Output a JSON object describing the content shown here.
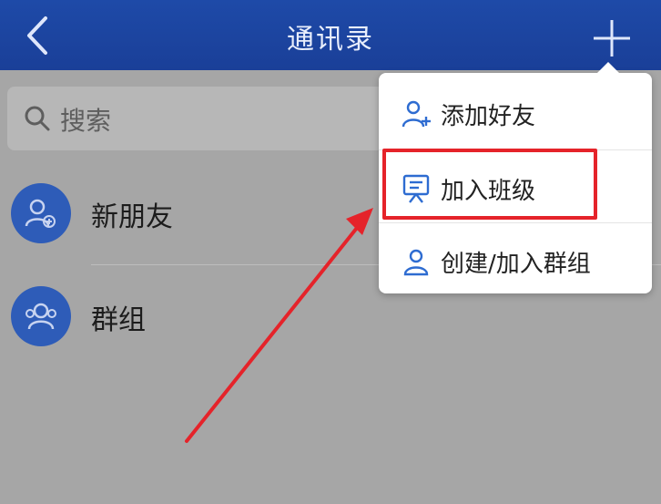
{
  "header": {
    "title": "通讯录",
    "back_icon": "chevron-left-icon",
    "add_icon": "plus-icon"
  },
  "search": {
    "placeholder": "搜索",
    "icon": "search-icon"
  },
  "list": {
    "items": [
      {
        "label": "新朋友",
        "icon": "add-user-icon"
      },
      {
        "label": "群组",
        "icon": "group-icon"
      }
    ]
  },
  "menu": {
    "items": [
      {
        "label": "添加好友",
        "icon": "add-friend-icon"
      },
      {
        "label": "加入班级",
        "icon": "class-board-icon"
      },
      {
        "label": "创建/加入群组",
        "icon": "group-icon"
      }
    ],
    "highlighted_item": "加入班级"
  },
  "colors": {
    "header_bg": "#1e4aa8",
    "accent_blue": "#2e5cb8",
    "highlight_red": "#e5232a",
    "overlay_gray": "#a6a6a6"
  }
}
